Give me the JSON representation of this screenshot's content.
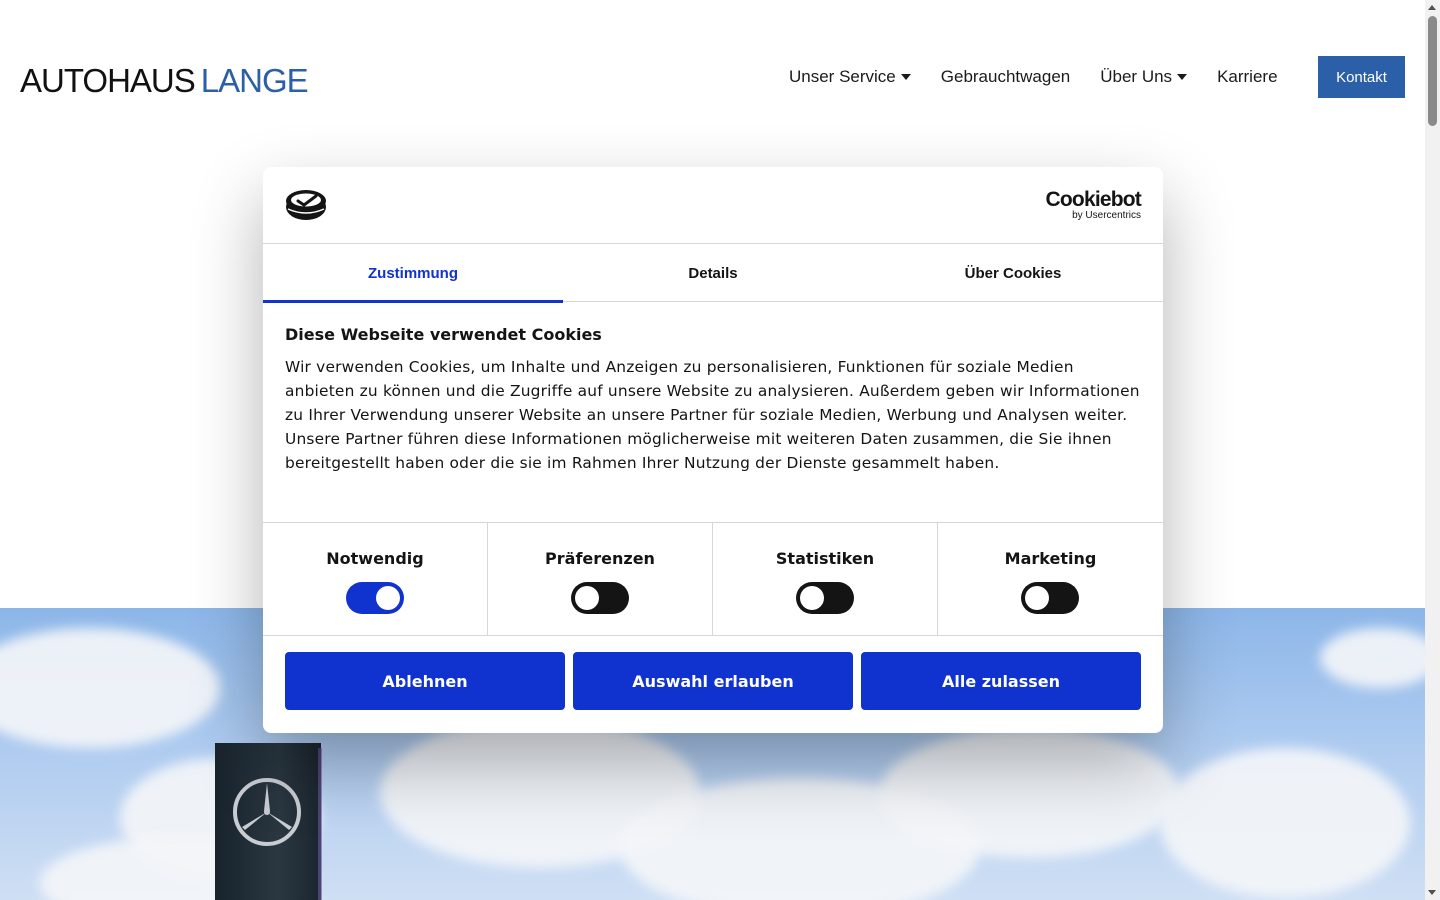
{
  "header": {
    "logo_part1": "AUTOHAUS",
    "logo_part2": "LANGE",
    "nav": [
      {
        "label": "Unser Service",
        "dropdown": true
      },
      {
        "label": "Gebrauchtwagen",
        "dropdown": false
      },
      {
        "label": "Über Uns",
        "dropdown": true
      },
      {
        "label": "Karriere",
        "dropdown": false
      }
    ],
    "contact_label": "Kontakt"
  },
  "dialog": {
    "brand": {
      "wordmark": "Cookiebot",
      "sub": "by Usercentrics"
    },
    "tabs": [
      {
        "label": "Zustimmung",
        "active": true
      },
      {
        "label": "Details",
        "active": false
      },
      {
        "label": "Über Cookies",
        "active": false
      }
    ],
    "title": "Diese Webseite verwendet Cookies",
    "text": "Wir verwenden Cookies, um Inhalte und Anzeigen zu personalisieren, Funktionen für soziale Medien anbieten zu können und die Zugriffe auf unsere Website zu analysieren. Außerdem geben wir Informationen zu Ihrer Verwendung unserer Website an unsere Partner für soziale Medien, Werbung und Analysen weiter. Unsere Partner führen diese Informationen möglicherweise mit weiteren Daten zusammen, die Sie ihnen bereitgestellt haben oder die sie im Rahmen Ihrer Nutzung der Dienste gesammelt haben.",
    "toggles": [
      {
        "label": "Notwendig",
        "on": true
      },
      {
        "label": "Präferenzen",
        "on": false
      },
      {
        "label": "Statistiken",
        "on": false
      },
      {
        "label": "Marketing",
        "on": false
      }
    ],
    "buttons": {
      "decline": "Ablehnen",
      "allow_selection": "Auswahl erlauben",
      "allow_all": "Alle zulassen"
    }
  },
  "colors": {
    "brand_blue": "#2b5fa8",
    "cookiebot_blue": "#1032cf"
  }
}
